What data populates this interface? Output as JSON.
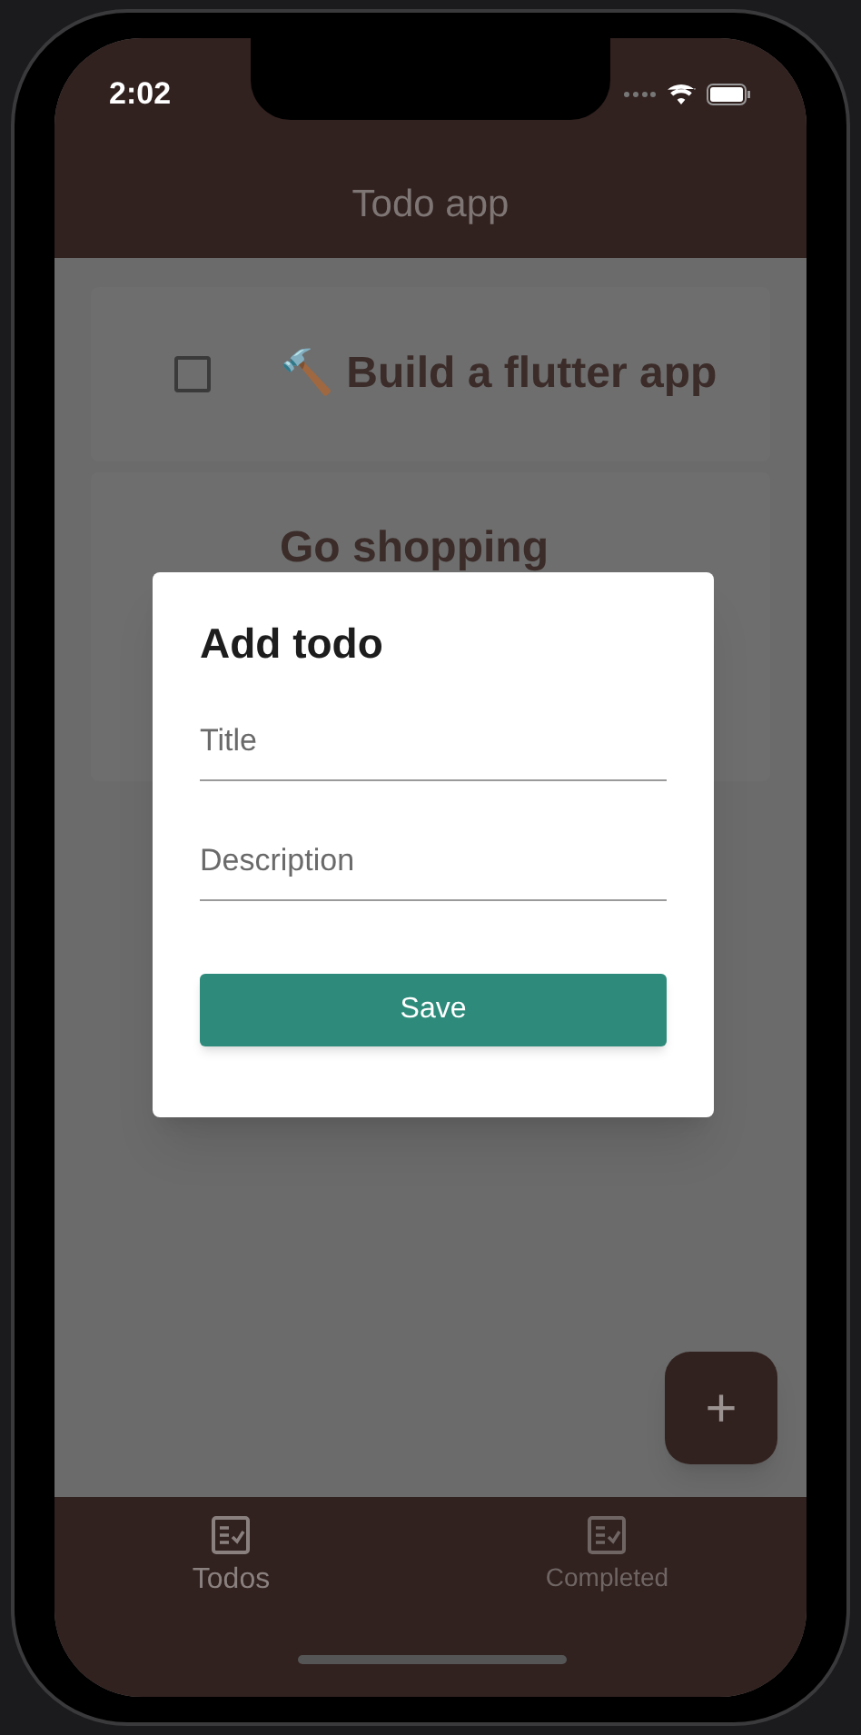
{
  "status_bar": {
    "time": "2:02"
  },
  "app_bar": {
    "title": "Todo app"
  },
  "todos": [
    {
      "title": "🔨 Build a flutter app",
      "checked": false
    },
    {
      "title": "Go shopping"
    }
  ],
  "dialog": {
    "title": "Add todo",
    "fields": [
      {
        "placeholder": "Title"
      },
      {
        "placeholder": "Description"
      }
    ],
    "button": "Save"
  },
  "fab": {
    "label": "+"
  },
  "bottom_nav": [
    {
      "label": "Todos",
      "selected": true
    },
    {
      "label": "Completed",
      "selected": false
    }
  ]
}
